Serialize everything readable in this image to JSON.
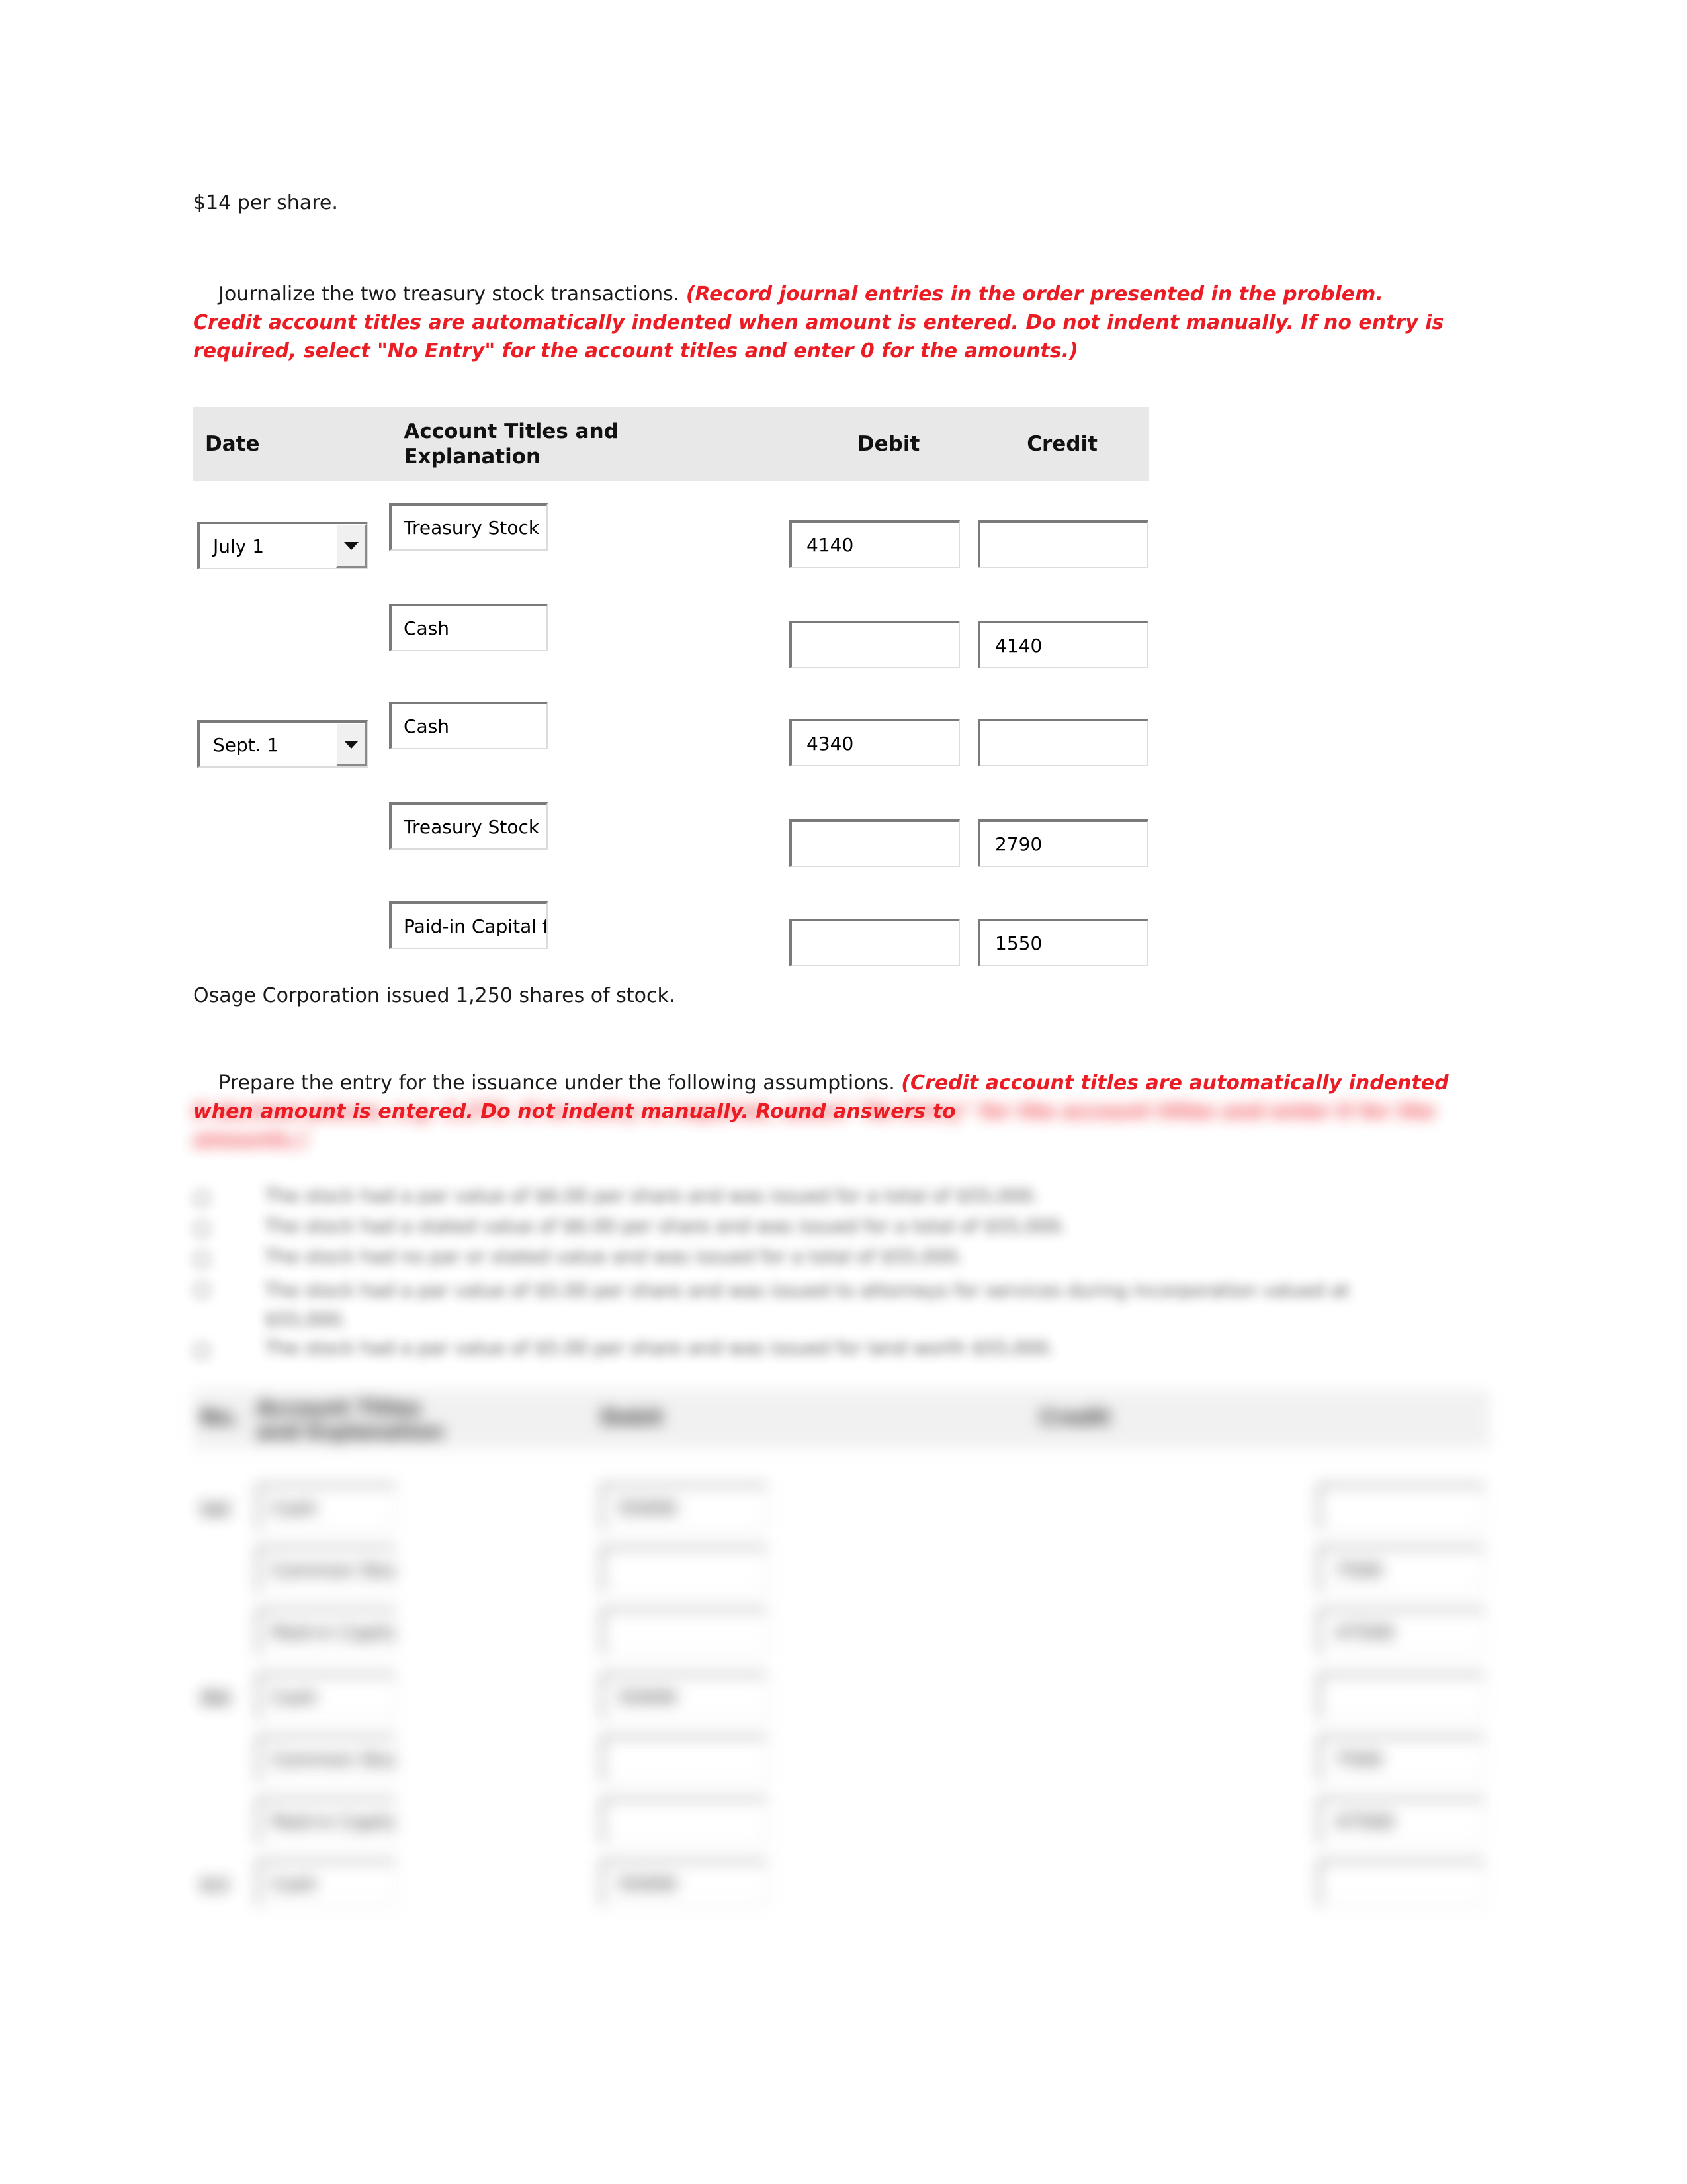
{
  "document": {
    "intro_line": "$14 per share.",
    "instruction_1_plain": "Journalize the two treasury stock transactions. ",
    "instruction_1_emphasis": "(Record journal entries in the order presented in the problem. Credit account titles are automatically indented when amount is entered. Do not indent manually. If no entry is required, select \"No Entry\" for the account titles and enter 0 for the amounts.)",
    "mid_line": "Osage Corporation issued 1,250 shares of stock.",
    "instruction_2_plain": "Prepare the entry for the issuance under the following assumptions. ",
    "instruction_2_emphasis": "(Credit account titles are automatically indented when amount is entered. Do not indent manually. Round answers to",
    "instruction_2_blurred": "0 decimal places, e.g. 5,275. If no entry is required, select \"No Entry\" for the account titles and enter 0 for the amounts.)"
  },
  "journal_table_1": {
    "headers": {
      "date": "Date",
      "account": "Account Titles and Explanation",
      "debit": "Debit",
      "credit": "Credit"
    },
    "rows": [
      {
        "date": "July 1",
        "has_date": true,
        "account": "Treasury Stock",
        "debit": "4140",
        "credit": ""
      },
      {
        "date": "",
        "has_date": false,
        "account": "Cash",
        "debit": "",
        "credit": "4140"
      },
      {
        "date": "Sept. 1",
        "has_date": true,
        "account": "Cash",
        "debit": "4340",
        "credit": ""
      },
      {
        "date": "",
        "has_date": false,
        "account": "Treasury Stock",
        "debit": "",
        "credit": "2790"
      },
      {
        "date": "",
        "has_date": false,
        "account": "Paid-in Capital from Treasury Stock",
        "debit": "",
        "credit": "1550"
      }
    ]
  },
  "assumption_options": [
    "The stock had a par value of $6.00 per share and was issued for a total of $55,000.",
    "The stock had a stated value of $6.00 per share and was issued for a total of $55,000.",
    "The stock had no par or stated value and was issued for a total of $55,000.",
    "The stock had a par value of $5.00 per share and was issued to attorneys for services during incorporation valued at $55,000.",
    "The stock had a par value of $5.00 per share and was issued for land worth $55,000."
  ],
  "journal_table_2": {
    "headers": {
      "no": "No.",
      "account": "Account Titles and Explanation",
      "debit": "Debit",
      "credit": "Credit"
    },
    "groups": [
      {
        "no": "(a)",
        "rows": [
          {
            "account": "Cash",
            "debit": "55000",
            "credit": ""
          },
          {
            "account": "Common Stock",
            "debit": "",
            "credit": "7500"
          },
          {
            "account": "Paid-in Capital",
            "debit": "",
            "credit": "47500"
          }
        ]
      },
      {
        "no": "(b)",
        "rows": [
          {
            "account": "Cash",
            "debit": "55000",
            "credit": ""
          },
          {
            "account": "Common Stock",
            "debit": "",
            "credit": "7500"
          },
          {
            "account": "Paid-in Capital",
            "debit": "",
            "credit": "47500"
          }
        ]
      },
      {
        "no": "(c)",
        "rows": [
          {
            "account": "Cash",
            "debit": "55000",
            "credit": ""
          }
        ]
      }
    ]
  },
  "colors": {
    "emphasis_red": "#ec1c24",
    "header_gray": "#e8e8e8",
    "control_border": "#7a7a7a",
    "page_background": "#ffffff"
  }
}
